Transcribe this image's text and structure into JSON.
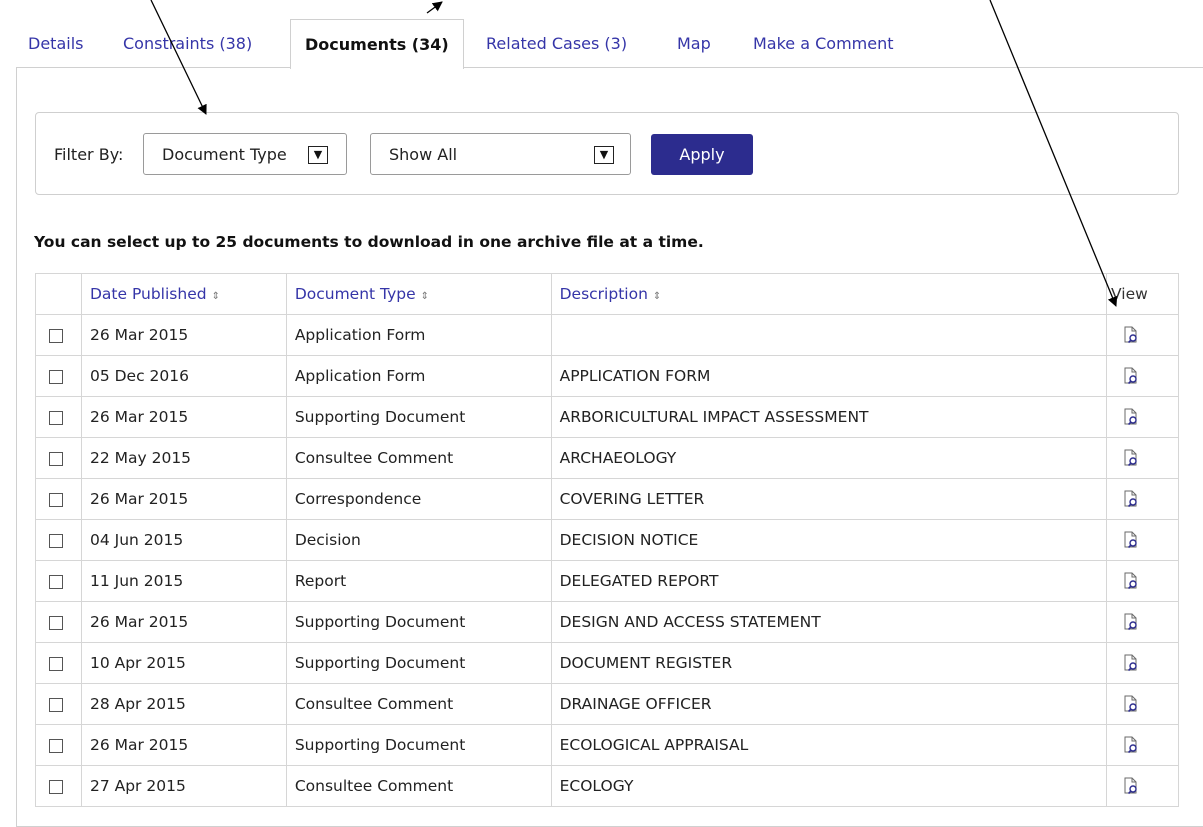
{
  "tabs": [
    {
      "label": "Details",
      "active": false
    },
    {
      "label": "Constraints (38)",
      "active": false
    },
    {
      "label": "Documents (34)",
      "active": true
    },
    {
      "label": "Related Cases (3)",
      "active": false
    },
    {
      "label": "Map",
      "active": false
    },
    {
      "label": "Make a Comment",
      "active": false
    }
  ],
  "filter": {
    "label": "Filter By:",
    "type_select": "Document Type",
    "value_select": "Show All",
    "apply_label": "Apply"
  },
  "note": "You can select up to 25 documents to download in one archive file at a time.",
  "table": {
    "headers": [
      "Date Published",
      "Document Type",
      "Description",
      "View"
    ],
    "sort_icon": "⇕",
    "rows": [
      {
        "date": "26 Mar 2015",
        "type": "Application Form",
        "description": ""
      },
      {
        "date": "05 Dec 2016",
        "type": "Application Form",
        "description": "APPLICATION FORM"
      },
      {
        "date": "26 Mar 2015",
        "type": "Supporting Document",
        "description": "ARBORICULTURAL IMPACT ASSESSMENT"
      },
      {
        "date": "22 May 2015",
        "type": "Consultee Comment",
        "description": "ARCHAEOLOGY"
      },
      {
        "date": "26 Mar 2015",
        "type": "Correspondence",
        "description": "COVERING LETTER"
      },
      {
        "date": "04 Jun 2015",
        "type": "Decision",
        "description": "DECISION NOTICE"
      },
      {
        "date": "11 Jun 2015",
        "type": "Report",
        "description": "DELEGATED REPORT"
      },
      {
        "date": "26 Mar 2015",
        "type": "Supporting Document",
        "description": "DESIGN AND ACCESS STATEMENT"
      },
      {
        "date": "10 Apr 2015",
        "type": "Supporting Document",
        "description": "DOCUMENT REGISTER"
      },
      {
        "date": "28 Apr 2015",
        "type": "Consultee Comment",
        "description": "DRAINAGE OFFICER"
      },
      {
        "date": "26 Mar 2015",
        "type": "Supporting Document",
        "description": "ECOLOGICAL APPRAISAL"
      },
      {
        "date": "27 Apr 2015",
        "type": "Consultee Comment",
        "description": "ECOLOGY"
      }
    ]
  },
  "colors": {
    "link": "#3535a8",
    "button": "#2c2c8e",
    "border": "#d6d6d6"
  },
  "icons": {
    "view": "document-view-icon",
    "checkbox": "checkbox-icon",
    "dropdown": "chevron-down-icon"
  }
}
